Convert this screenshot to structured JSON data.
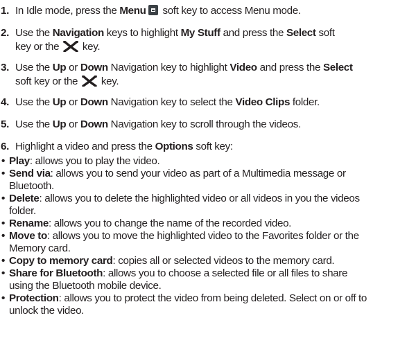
{
  "steps": [
    {
      "num": "1.",
      "t1": "In Idle mode, press the ",
      "b1": "Menu",
      "t2": " soft key to access Menu mode."
    },
    {
      "num": "2.",
      "t1": "Use the ",
      "b1": "Navigation",
      "t2": " keys to highlight ",
      "b2": "My Stuff",
      "t3": " and press the ",
      "b3": "Select",
      "t4": " soft",
      "l2": "key or the ",
      "l2b": " key."
    },
    {
      "num": "3.",
      "t1": "Use the ",
      "b1": "Up",
      "t2": " or ",
      "b2": "Down",
      "t3": " Navigation key to highlight ",
      "b3": "Video",
      "t4": " and press the ",
      "b4": "Select",
      "l2": "soft key or the ",
      "l2b": " key."
    },
    {
      "num": "4.",
      "t1": "Use the ",
      "b1": "Up",
      "t2": " or ",
      "b2": "Down",
      "t3": " Navigation key to select the ",
      "b3": "Video Clips",
      "t4": " folder."
    },
    {
      "num": "5.",
      "t1": "Use the ",
      "b1": "Up",
      "t2": " or ",
      "b2": "Down",
      "t3": " Navigation key to scroll through the videos."
    },
    {
      "num": "6.",
      "t1": "Highlight a video and press the ",
      "b1": "Options",
      "t2": " soft key:"
    }
  ],
  "options": [
    {
      "term": "Play",
      "l1": ": allows you to play the video."
    },
    {
      "term": "Send via",
      "l1": ": allows you to send your video as part of a Multimedia message or",
      "l2": "Bluetooth."
    },
    {
      "term": "Delete",
      "l1": ": allows you to delete the highlighted video or all videos in you the videos",
      "l2": "folder."
    },
    {
      "term": "Rename",
      "l1": ": allows you to change the name of the recorded video."
    },
    {
      "term": "Move to",
      "l1": ": allows you to move the highlighted video to the Favorites folder or the",
      "l2": "Memory card."
    },
    {
      "term": "Copy to memory card",
      "l1": ": copies all or selected videos to the memory card."
    },
    {
      "term": "Share for Bluetooth",
      "l1": ": allows you to choose a selected file or all files to share",
      "l2": "using the Bluetooth mobile device."
    },
    {
      "term": "Protection",
      "l1": ": allows you to protect the video from being deleted. Select on or off to",
      "l2": "unlock the video."
    }
  ],
  "bullet": "•",
  "icons": {
    "menu": "menu-softkey-icon",
    "select": "select-x-key-icon"
  }
}
